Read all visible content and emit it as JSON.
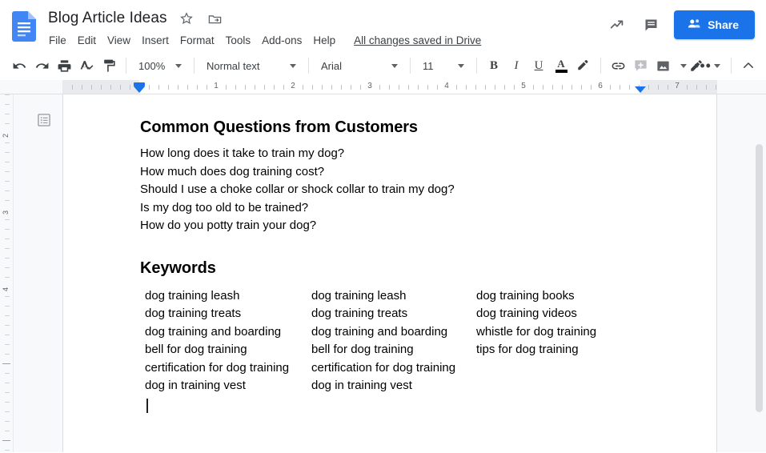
{
  "header": {
    "logo_icon": "google-docs-logo",
    "doc_title": "Blog Article Ideas",
    "star_icon": "star-outline-icon",
    "move_icon": "move-to-folder-icon",
    "menus": [
      "File",
      "Edit",
      "View",
      "Insert",
      "Format",
      "Tools",
      "Add-ons",
      "Help"
    ],
    "save_status": "All changes saved in Drive",
    "activity_icon": "activity-trend-icon",
    "comments_icon": "comment-history-icon",
    "share_label": "Share",
    "share_icon": "person-add-icon",
    "share_color": "#1a73e8"
  },
  "toolbar": {
    "undo_icon": "undo-icon",
    "redo_icon": "redo-icon",
    "print_icon": "print-icon",
    "spellcheck_icon": "spellcheck-icon",
    "paint_icon": "paint-format-icon",
    "zoom_value": "100%",
    "style_value": "Normal text",
    "font_value": "Arial",
    "size_value": "11",
    "bold_label": "B",
    "italic_label": "I",
    "underline_label": "U",
    "textcolor_label": "A",
    "textcolor_swatch": "#000000",
    "highlight_icon": "highlight-pen-icon",
    "link_icon": "insert-link-icon",
    "comment_icon": "add-comment-icon",
    "image_icon": "insert-image-icon",
    "more_icon": "more-options-icon",
    "mode_icon": "editing-mode-pencil-icon",
    "collapse_icon": "collapse-toolbar-chevron-icon"
  },
  "ruler": {
    "numbers": [
      "1",
      "1",
      "2",
      "3",
      "4",
      "5",
      "6",
      "7"
    ],
    "left_indent_marker": "left-indent-marker",
    "right_indent_marker": "right-indent-marker"
  },
  "vertical_ruler": {
    "numbers": [
      "2",
      "3",
      "4"
    ]
  },
  "sidebar": {
    "outline_icon": "document-outline-icon"
  },
  "document": {
    "heading1": "Common Questions from Customers",
    "questions": [
      "How long does it take to train my dog?",
      "How much does dog training cost?",
      "Should I use a choke collar or shock collar to train my dog?",
      "Is my dog too old to be trained?",
      "How do you potty train your dog?"
    ],
    "heading2": "Keywords",
    "keyword_columns": [
      [
        "dog training leash",
        "dog training treats",
        "dog training and boarding",
        "bell for dog training",
        "certification for dog training",
        "dog in training vest"
      ],
      [
        "dog training leash",
        "dog training treats",
        "dog training and boarding",
        "bell for dog training",
        "certification for dog training",
        "dog in training vest"
      ],
      [
        "dog training books",
        "dog training videos",
        "whistle for dog training",
        "tips for dog training"
      ]
    ],
    "text_cursor": "text-caret"
  },
  "scrollbar": {
    "thumb": "vertical-scrollbar-thumb"
  }
}
